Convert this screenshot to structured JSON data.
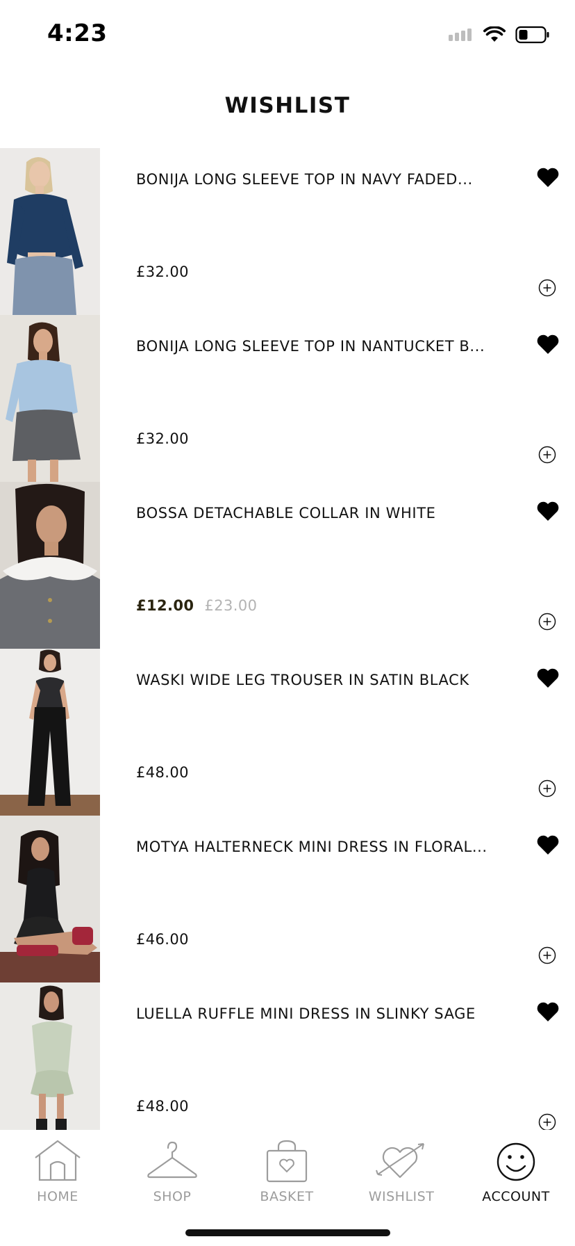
{
  "status_bar": {
    "time": "4:23"
  },
  "header": {
    "title": "WISHLIST"
  },
  "wishlist": {
    "items": [
      {
        "name": "BONIJA LONG SLEEVE TOP IN NAVY FADED...",
        "price": "£32.00",
        "old_price": ""
      },
      {
        "name": "BONIJA LONG SLEEVE TOP IN NANTUCKET B...",
        "price": "£32.00",
        "old_price": ""
      },
      {
        "name": "BOSSA DETACHABLE COLLAR IN WHITE",
        "price": "£12.00",
        "old_price": "£23.00"
      },
      {
        "name": "WASKI WIDE LEG TROUSER IN SATIN BLACK",
        "price": "£48.00",
        "old_price": ""
      },
      {
        "name": "MOTYA HALTERNECK MINI DRESS IN FLORAL...",
        "price": "£46.00",
        "old_price": ""
      },
      {
        "name": "LUELLA RUFFLE MINI DRESS IN SLINKY SAGE",
        "price": "£48.00",
        "old_price": ""
      }
    ]
  },
  "tab_bar": {
    "tabs": [
      {
        "label": "HOME",
        "icon": "home-icon"
      },
      {
        "label": "SHOP",
        "icon": "hanger-icon"
      },
      {
        "label": "BASKET",
        "icon": "basket-icon"
      },
      {
        "label": "WISHLIST",
        "icon": "heart-arrow-icon"
      },
      {
        "label": "ACCOUNT",
        "icon": "smiley-icon"
      }
    ],
    "active": "ACCOUNT"
  },
  "colors": {
    "accent": "#111111",
    "inactive": "#9c9c9c",
    "sale_price": "#2a2410",
    "old_price": "#b3b3b3"
  }
}
